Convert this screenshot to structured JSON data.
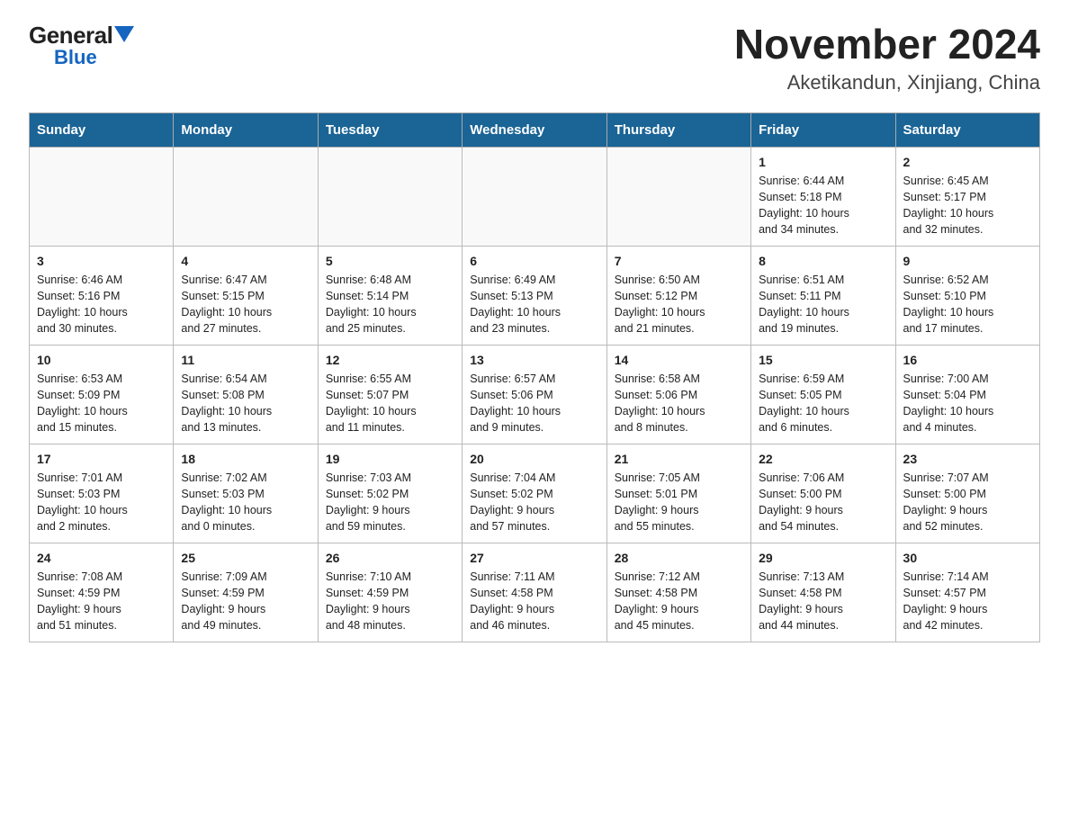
{
  "logo": {
    "general": "General",
    "blue_arrow": "▶",
    "blue": "Blue"
  },
  "header": {
    "title": "November 2024",
    "subtitle": "Aketikandun, Xinjiang, China"
  },
  "weekdays": [
    "Sunday",
    "Monday",
    "Tuesday",
    "Wednesday",
    "Thursday",
    "Friday",
    "Saturday"
  ],
  "weeks": [
    [
      {
        "day": "",
        "info": ""
      },
      {
        "day": "",
        "info": ""
      },
      {
        "day": "",
        "info": ""
      },
      {
        "day": "",
        "info": ""
      },
      {
        "day": "",
        "info": ""
      },
      {
        "day": "1",
        "info": "Sunrise: 6:44 AM\nSunset: 5:18 PM\nDaylight: 10 hours\nand 34 minutes."
      },
      {
        "day": "2",
        "info": "Sunrise: 6:45 AM\nSunset: 5:17 PM\nDaylight: 10 hours\nand 32 minutes."
      }
    ],
    [
      {
        "day": "3",
        "info": "Sunrise: 6:46 AM\nSunset: 5:16 PM\nDaylight: 10 hours\nand 30 minutes."
      },
      {
        "day": "4",
        "info": "Sunrise: 6:47 AM\nSunset: 5:15 PM\nDaylight: 10 hours\nand 27 minutes."
      },
      {
        "day": "5",
        "info": "Sunrise: 6:48 AM\nSunset: 5:14 PM\nDaylight: 10 hours\nand 25 minutes."
      },
      {
        "day": "6",
        "info": "Sunrise: 6:49 AM\nSunset: 5:13 PM\nDaylight: 10 hours\nand 23 minutes."
      },
      {
        "day": "7",
        "info": "Sunrise: 6:50 AM\nSunset: 5:12 PM\nDaylight: 10 hours\nand 21 minutes."
      },
      {
        "day": "8",
        "info": "Sunrise: 6:51 AM\nSunset: 5:11 PM\nDaylight: 10 hours\nand 19 minutes."
      },
      {
        "day": "9",
        "info": "Sunrise: 6:52 AM\nSunset: 5:10 PM\nDaylight: 10 hours\nand 17 minutes."
      }
    ],
    [
      {
        "day": "10",
        "info": "Sunrise: 6:53 AM\nSunset: 5:09 PM\nDaylight: 10 hours\nand 15 minutes."
      },
      {
        "day": "11",
        "info": "Sunrise: 6:54 AM\nSunset: 5:08 PM\nDaylight: 10 hours\nand 13 minutes."
      },
      {
        "day": "12",
        "info": "Sunrise: 6:55 AM\nSunset: 5:07 PM\nDaylight: 10 hours\nand 11 minutes."
      },
      {
        "day": "13",
        "info": "Sunrise: 6:57 AM\nSunset: 5:06 PM\nDaylight: 10 hours\nand 9 minutes."
      },
      {
        "day": "14",
        "info": "Sunrise: 6:58 AM\nSunset: 5:06 PM\nDaylight: 10 hours\nand 8 minutes."
      },
      {
        "day": "15",
        "info": "Sunrise: 6:59 AM\nSunset: 5:05 PM\nDaylight: 10 hours\nand 6 minutes."
      },
      {
        "day": "16",
        "info": "Sunrise: 7:00 AM\nSunset: 5:04 PM\nDaylight: 10 hours\nand 4 minutes."
      }
    ],
    [
      {
        "day": "17",
        "info": "Sunrise: 7:01 AM\nSunset: 5:03 PM\nDaylight: 10 hours\nand 2 minutes."
      },
      {
        "day": "18",
        "info": "Sunrise: 7:02 AM\nSunset: 5:03 PM\nDaylight: 10 hours\nand 0 minutes."
      },
      {
        "day": "19",
        "info": "Sunrise: 7:03 AM\nSunset: 5:02 PM\nDaylight: 9 hours\nand 59 minutes."
      },
      {
        "day": "20",
        "info": "Sunrise: 7:04 AM\nSunset: 5:02 PM\nDaylight: 9 hours\nand 57 minutes."
      },
      {
        "day": "21",
        "info": "Sunrise: 7:05 AM\nSunset: 5:01 PM\nDaylight: 9 hours\nand 55 minutes."
      },
      {
        "day": "22",
        "info": "Sunrise: 7:06 AM\nSunset: 5:00 PM\nDaylight: 9 hours\nand 54 minutes."
      },
      {
        "day": "23",
        "info": "Sunrise: 7:07 AM\nSunset: 5:00 PM\nDaylight: 9 hours\nand 52 minutes."
      }
    ],
    [
      {
        "day": "24",
        "info": "Sunrise: 7:08 AM\nSunset: 4:59 PM\nDaylight: 9 hours\nand 51 minutes."
      },
      {
        "day": "25",
        "info": "Sunrise: 7:09 AM\nSunset: 4:59 PM\nDaylight: 9 hours\nand 49 minutes."
      },
      {
        "day": "26",
        "info": "Sunrise: 7:10 AM\nSunset: 4:59 PM\nDaylight: 9 hours\nand 48 minutes."
      },
      {
        "day": "27",
        "info": "Sunrise: 7:11 AM\nSunset: 4:58 PM\nDaylight: 9 hours\nand 46 minutes."
      },
      {
        "day": "28",
        "info": "Sunrise: 7:12 AM\nSunset: 4:58 PM\nDaylight: 9 hours\nand 45 minutes."
      },
      {
        "day": "29",
        "info": "Sunrise: 7:13 AM\nSunset: 4:58 PM\nDaylight: 9 hours\nand 44 minutes."
      },
      {
        "day": "30",
        "info": "Sunrise: 7:14 AM\nSunset: 4:57 PM\nDaylight: 9 hours\nand 42 minutes."
      }
    ]
  ]
}
